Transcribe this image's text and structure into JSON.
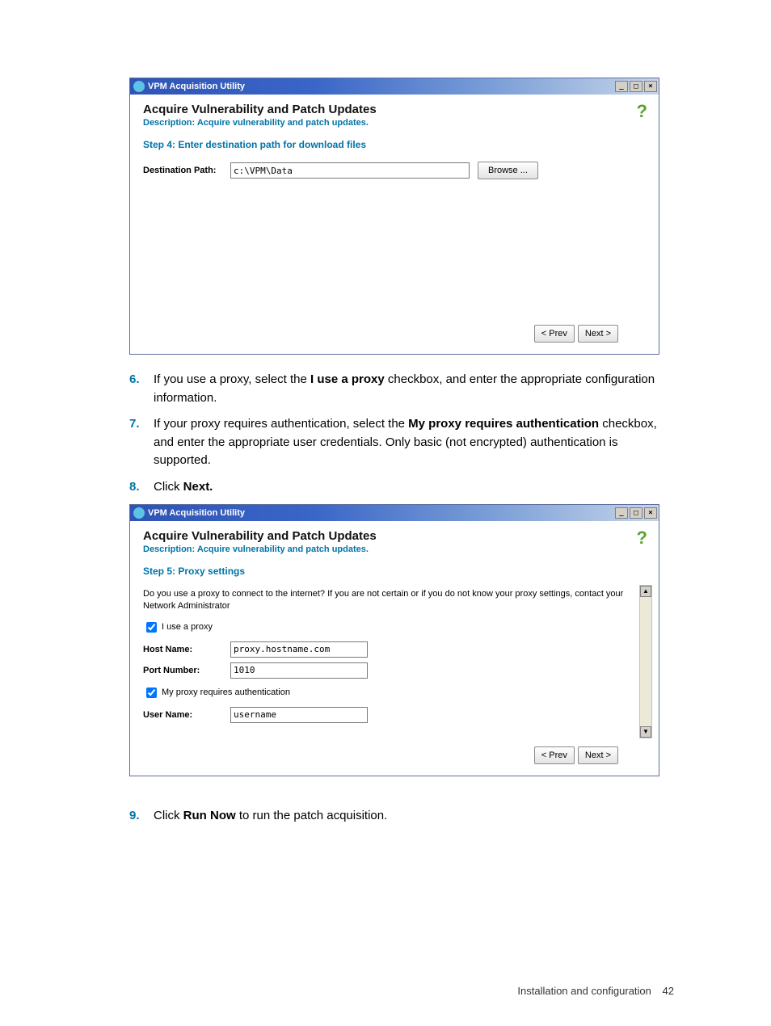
{
  "dialog1": {
    "app_title": "VPM Acquisition Utility",
    "header_title": "Acquire Vulnerability and Patch Updates",
    "header_desc": "Description: Acquire vulnerability and patch updates.",
    "step_label": "Step 4: Enter destination path for download files",
    "dest_label": "Destination Path:",
    "dest_value": "c:\\VPM\\Data",
    "browse_label": "Browse ...",
    "prev_label": "< Prev",
    "next_label": "Next >",
    "min": "_",
    "max": "□",
    "close": "×"
  },
  "steps": {
    "s6_num": "6.",
    "s6_pre": "If you use a proxy, select the ",
    "s6_bold": "I use a proxy",
    "s6_post": " checkbox, and enter the appropriate configuration information.",
    "s7_num": "7.",
    "s7_pre": "If your proxy requires authentication, select the ",
    "s7_bold": "My proxy requires authentication",
    "s7_post": " checkbox, and enter the appropriate user credentials. Only basic (not encrypted) authentication is supported.",
    "s8_num": "8.",
    "s8_pre": "Click ",
    "s8_bold": "Next.",
    "s9_num": "9.",
    "s9_pre": "Click ",
    "s9_bold": "Run Now",
    "s9_post": " to run the patch acquisition."
  },
  "dialog2": {
    "app_title": "VPM Acquisition Utility",
    "header_title": "Acquire Vulnerability and Patch Updates",
    "header_desc": "Description: Acquire vulnerability and patch updates.",
    "step_label": "Step 5: Proxy settings",
    "intro": "Do you use a proxy to connect to the internet? If you are not certain or if you do not know your proxy settings, contact your Network Administrator",
    "use_proxy_label": "I use a proxy",
    "host_label": "Host Name:",
    "host_value": "proxy.hostname.com",
    "port_label": "Port Number:",
    "port_value": "1010",
    "auth_label": "My proxy requires authentication",
    "user_label": "User Name:",
    "user_value": "username",
    "prev_label": "< Prev",
    "next_label": "Next >"
  },
  "footer": {
    "text": "Installation and configuration",
    "page": "42"
  }
}
